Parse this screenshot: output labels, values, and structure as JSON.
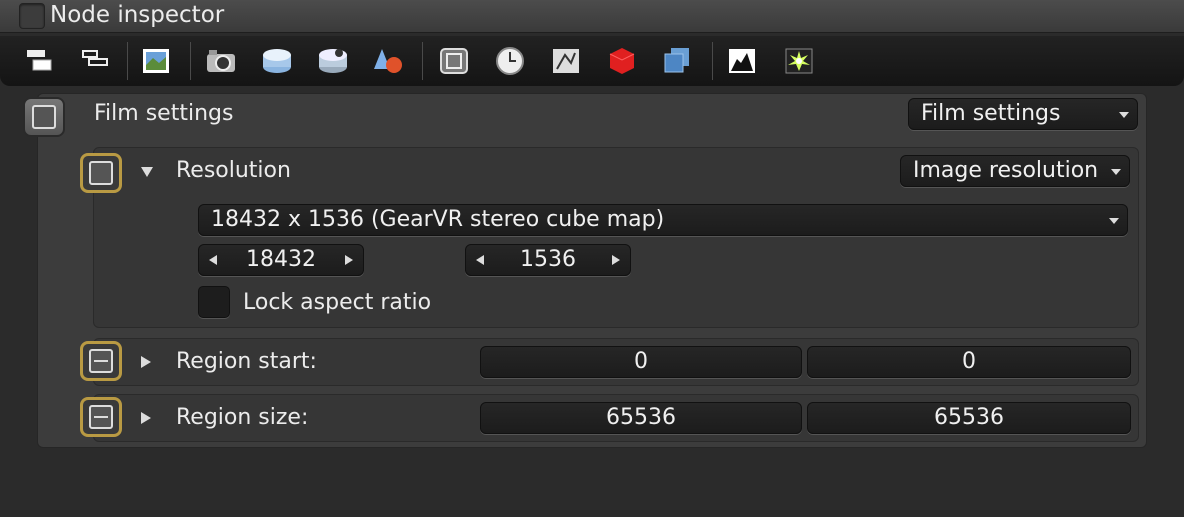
{
  "window": {
    "title": "Node inspector"
  },
  "toolbar": {
    "icons": [
      "stack-icon",
      "stack-outline-icon",
      "image-icon",
      "camera-icon",
      "environment-icon",
      "kernel-icon",
      "material-icon",
      "film-icon",
      "clock-icon",
      "geometry-icon",
      "red-cube-icon",
      "blue-cubes-icon",
      "histogram-icon",
      "light-burst-icon"
    ]
  },
  "film_settings": {
    "label": "Film settings",
    "dropdown_value": "Film settings"
  },
  "resolution": {
    "label": "Resolution",
    "dropdown_value": "Image resolution",
    "preset": "18432 x 1536 (GearVR stereo cube map)",
    "width": "18432",
    "height": "1536",
    "lock_label": "Lock aspect ratio"
  },
  "region_start": {
    "label": "Region start:",
    "x": "0",
    "y": "0"
  },
  "region_size": {
    "label": "Region size:",
    "x": "65536",
    "y": "65536"
  },
  "colors": {
    "accent": "#b99a43",
    "background": "#2b2b2b",
    "panel": "#3c3c3c"
  }
}
